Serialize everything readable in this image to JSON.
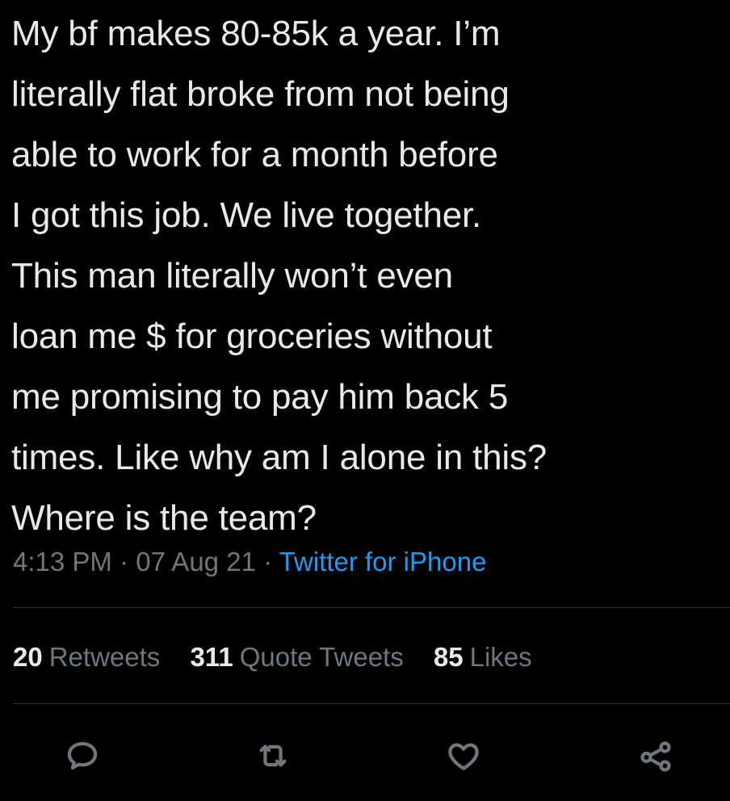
{
  "tweet": {
    "text": "My bf makes 80-85k a year. I’m\nliterally flat broke from not being\nable to work for a month before\nI got this job. We live together.\nThis man literally won’t even\nloan me $ for groceries without\nme promising to pay him back 5\ntimes. Like why am I alone in this?\nWhere is the team?",
    "time": "4:13 PM",
    "date": "07 Aug 21",
    "separator": "·",
    "source": "Twitter for iPhone"
  },
  "stats": {
    "retweets": {
      "count": "20",
      "label": "Retweets"
    },
    "quote_tweets": {
      "count": "311",
      "label": "Quote Tweets"
    },
    "likes": {
      "count": "85",
      "label": "Likes"
    }
  },
  "actions": [
    {
      "name": "reply",
      "icon": "reply-icon"
    },
    {
      "name": "retweet",
      "icon": "retweet-icon"
    },
    {
      "name": "like",
      "icon": "heart-icon"
    },
    {
      "name": "share",
      "icon": "share-icon"
    }
  ],
  "colors": {
    "background": "#000000",
    "text": "#e7e9ea",
    "secondary_text": "#71767b",
    "link": "#1d9bf0",
    "divider": "#2f3336"
  }
}
